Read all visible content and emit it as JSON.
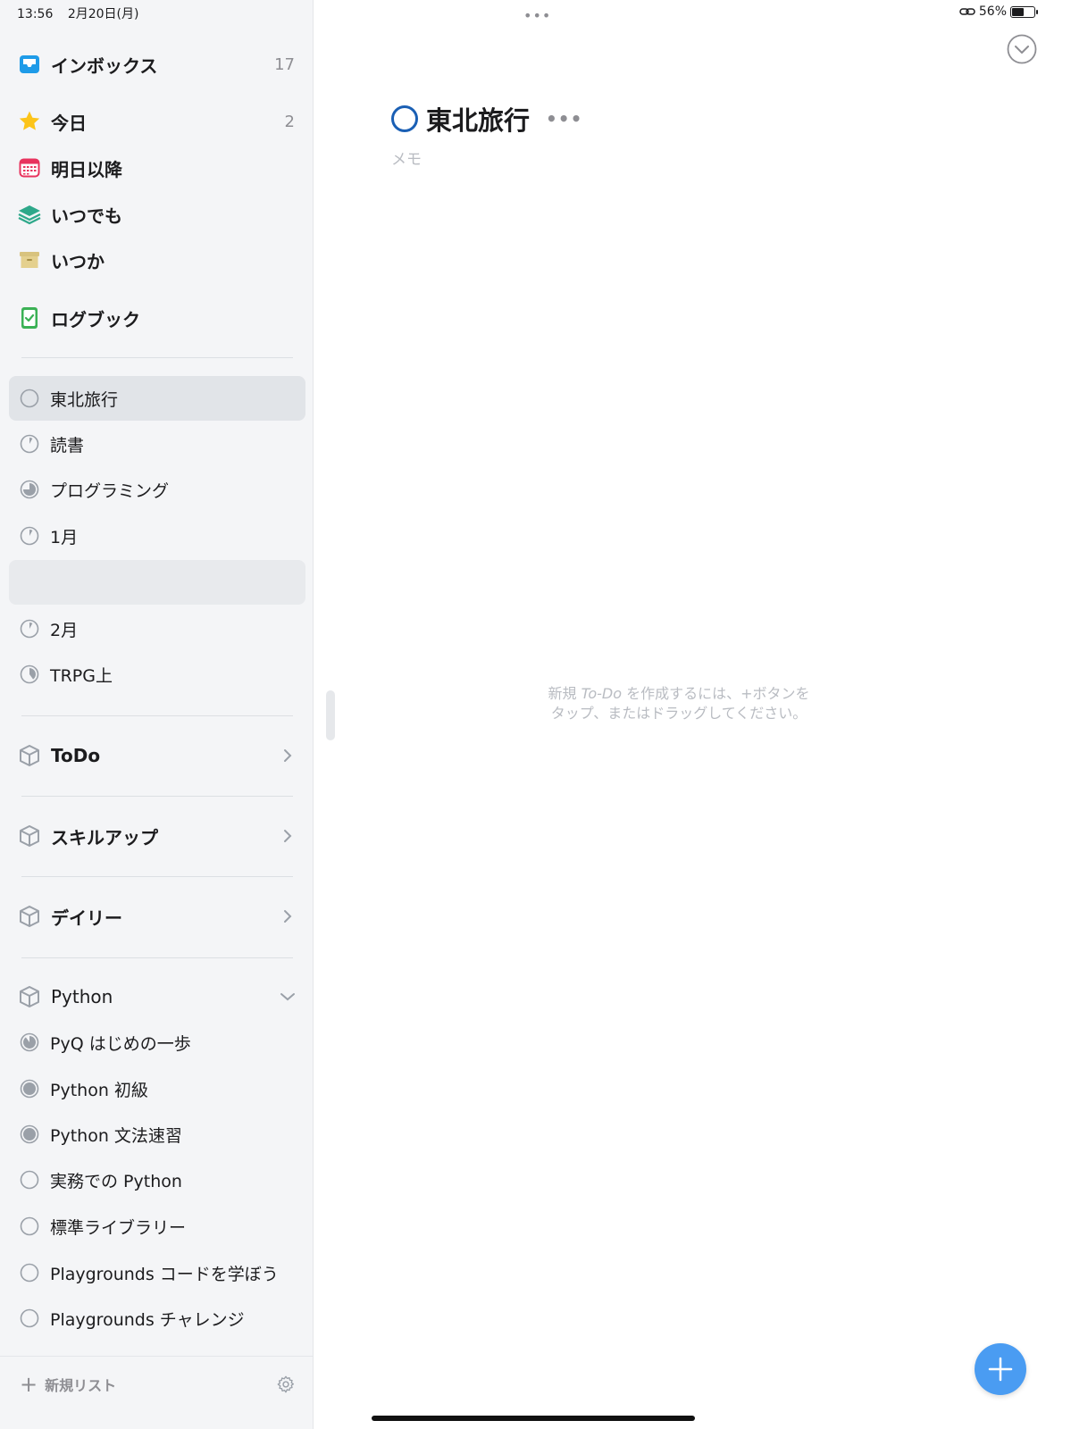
{
  "status": {
    "time": "13:56",
    "date": "2月20日(月)",
    "battery": "56%",
    "top_dots": "•••"
  },
  "sidebar": {
    "nav": [
      {
        "label": "インボックス",
        "count": "17",
        "icon": "inbox-icon"
      },
      {
        "label": "今日",
        "count": "2",
        "icon": "star-icon"
      },
      {
        "label": "明日以降",
        "count": "",
        "icon": "calendar-icon"
      },
      {
        "label": "いつでも",
        "count": "",
        "icon": "layers-icon"
      },
      {
        "label": "いつか",
        "count": "",
        "icon": "archive-box-icon"
      },
      {
        "label": "ログブック",
        "count": "",
        "icon": "logbook-icon"
      }
    ],
    "projects": [
      {
        "label": "東北旅行",
        "progress": 0
      },
      {
        "label": "読書",
        "progress": 0.08
      },
      {
        "label": "プログラミング",
        "progress": 0.75
      },
      {
        "label": "1月",
        "progress": 0.08
      },
      {
        "label": "",
        "progress": null
      },
      {
        "label": "2月",
        "progress": 0.08
      },
      {
        "label": "TRPG上",
        "progress": 0.4
      }
    ],
    "areas": [
      {
        "label": "ToDo"
      },
      {
        "label": "スキルアップ"
      },
      {
        "label": "デイリー"
      }
    ],
    "python_area": {
      "label": "Python",
      "projects": [
        {
          "label": "PyQ はじめの一歩",
          "progress": 0.9
        },
        {
          "label": "Python 初級",
          "progress": 1
        },
        {
          "label": "Python 文法速習",
          "progress": 1
        },
        {
          "label": "実務での Python",
          "progress": 0
        },
        {
          "label": "標準ライブラリー",
          "progress": 0
        },
        {
          "label": "Playgrounds コードを学ぼう",
          "progress": 0
        },
        {
          "label": "Playgrounds チャレンジ",
          "progress": 0
        }
      ]
    },
    "footer": {
      "new_list_plus": "+",
      "new_list_label": "新規リスト"
    }
  },
  "main": {
    "title": "東北旅行",
    "title_more": "•••",
    "memo_placeholder": "メモ",
    "empty_hint_pre": "新規 ",
    "empty_hint_em": "To-Do",
    "empty_hint_post": " を作成するには、+ボタンをタップ、またはドラッグしてください。"
  },
  "colors": {
    "accent": "#1a5fb4",
    "fab": "#4a9cf2",
    "sidebar_bg": "#f4f5f7"
  }
}
